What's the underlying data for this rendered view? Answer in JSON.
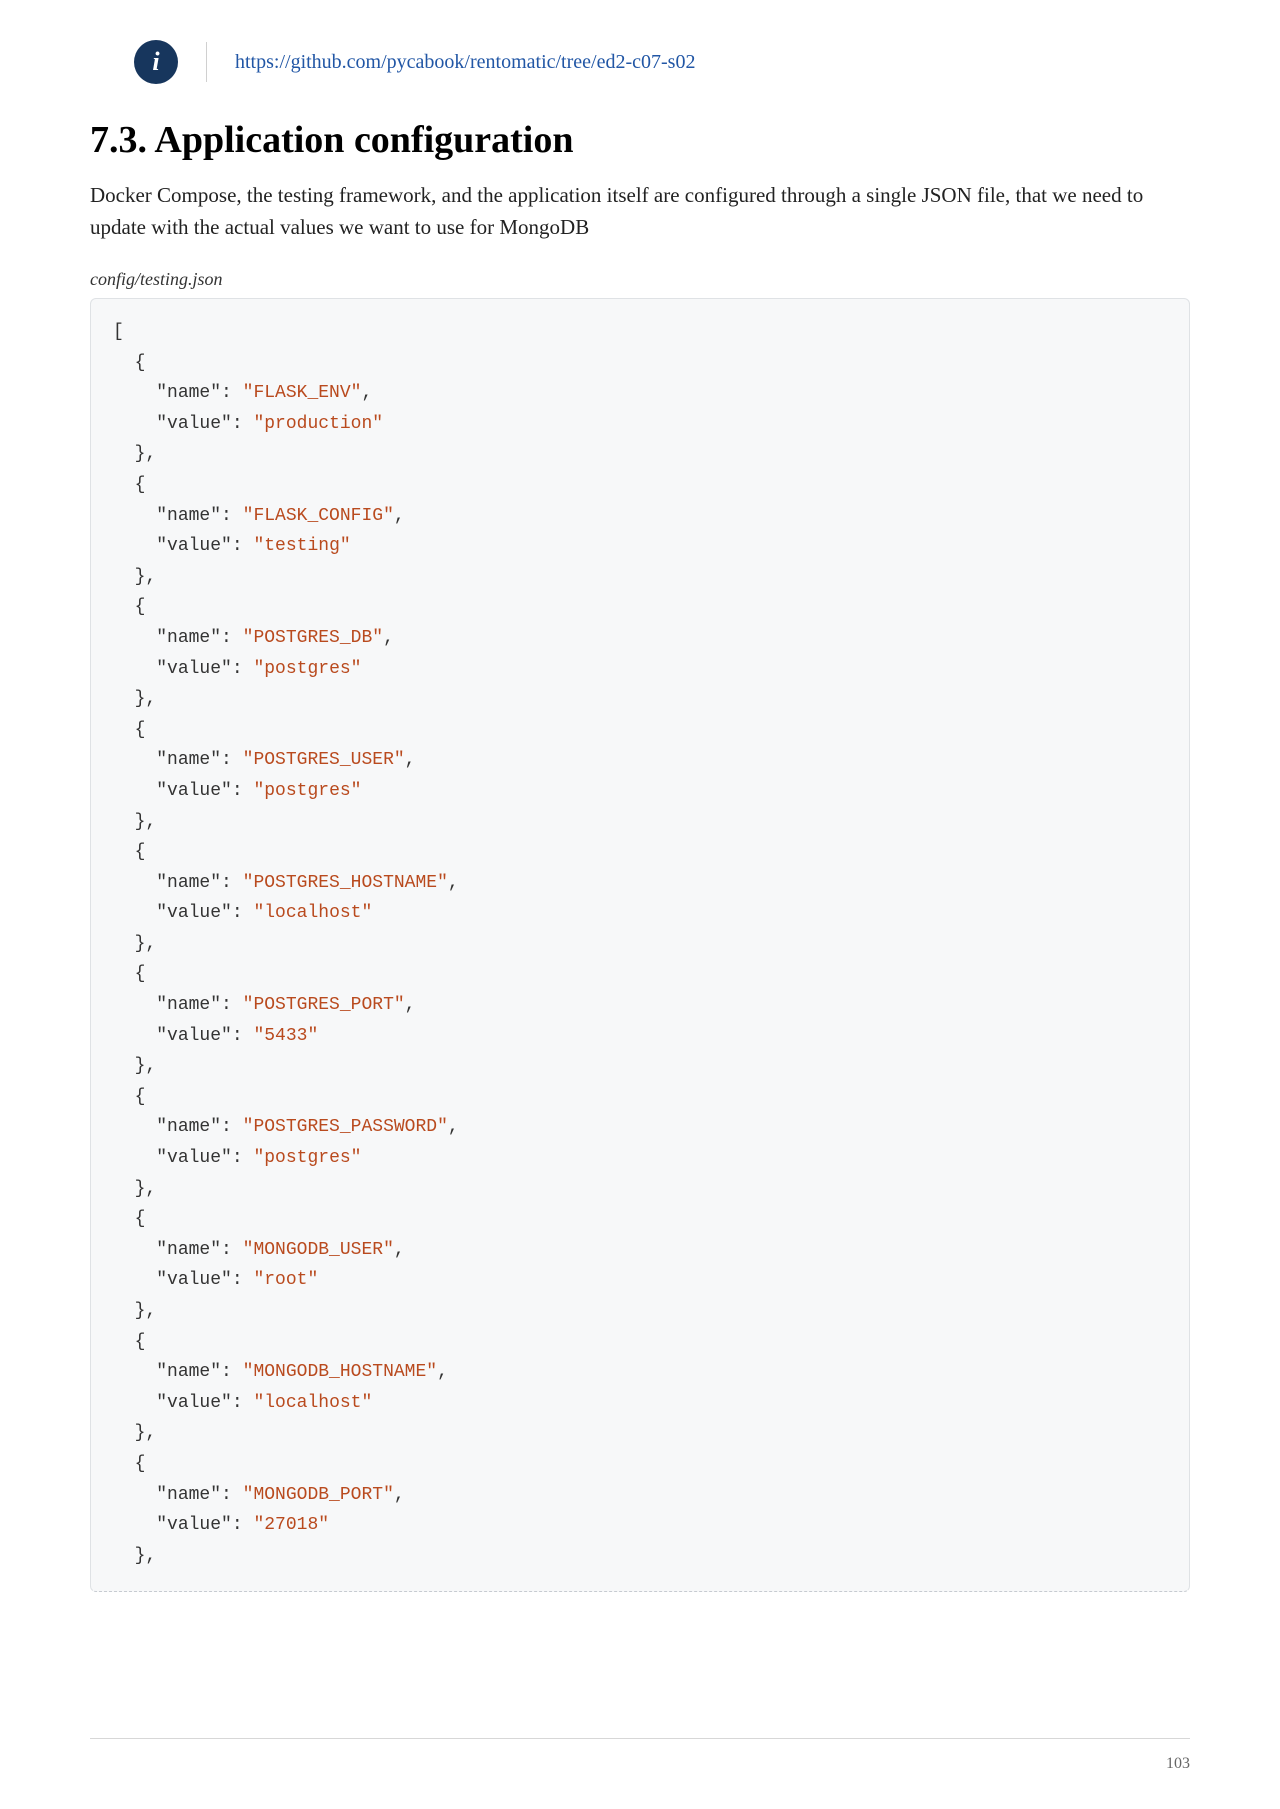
{
  "info": {
    "icon_label": "i",
    "link_text": "https://github.com/pycabook/rentomatic/tree/ed2-c07-s02"
  },
  "section": {
    "heading": "7.3. Application configuration",
    "paragraph": "Docker Compose, the testing framework, and the application itself are configured through a single JSON file, that we need to update with the actual values we want to use for MongoDB"
  },
  "code": {
    "title": "config/testing.json",
    "entries": [
      {
        "name": "FLASK_ENV",
        "value": "production"
      },
      {
        "name": "FLASK_CONFIG",
        "value": "testing"
      },
      {
        "name": "POSTGRES_DB",
        "value": "postgres"
      },
      {
        "name": "POSTGRES_USER",
        "value": "postgres"
      },
      {
        "name": "POSTGRES_HOSTNAME",
        "value": "localhost"
      },
      {
        "name": "POSTGRES_PORT",
        "value": "5433"
      },
      {
        "name": "POSTGRES_PASSWORD",
        "value": "postgres"
      },
      {
        "name": "MONGODB_USER",
        "value": "root"
      },
      {
        "name": "MONGODB_HOSTNAME",
        "value": "localhost"
      },
      {
        "name": "MONGODB_PORT",
        "value": "27018"
      }
    ],
    "tokens": {
      "name_key": "\"name\"",
      "value_key": "\"value\"",
      "colon": ": ",
      "open_arr": "[",
      "open_obj": "  {",
      "close_obj": "  },",
      "indent": "    "
    }
  },
  "page_number": "103"
}
